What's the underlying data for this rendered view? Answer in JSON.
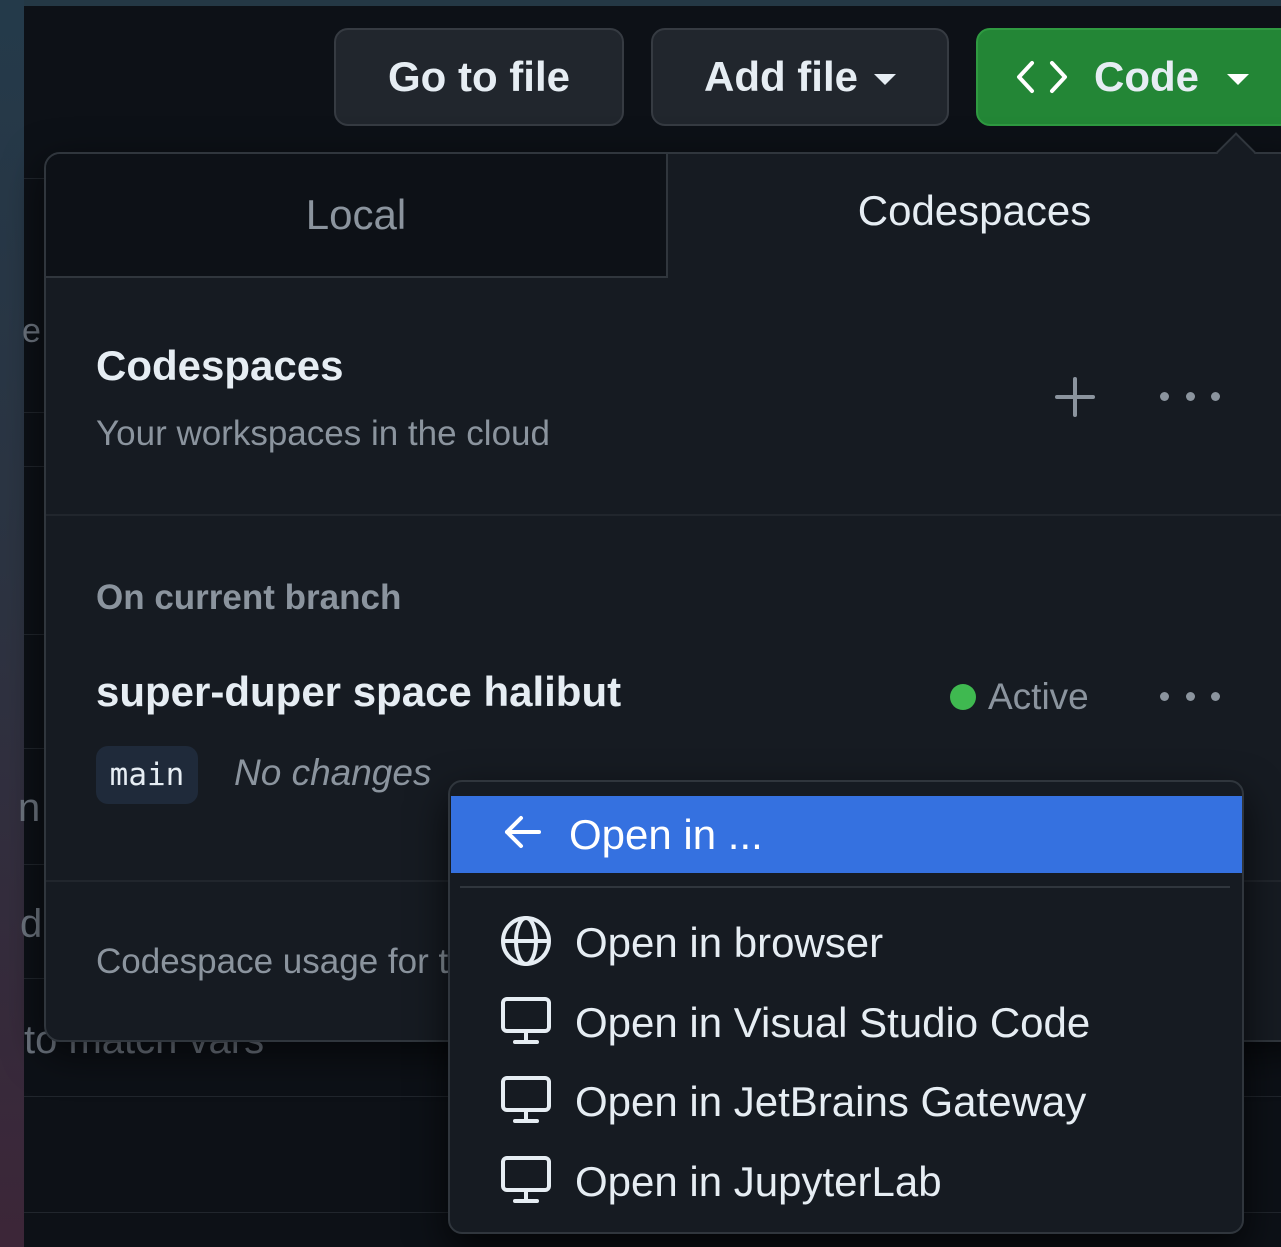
{
  "toolbar": {
    "goto_file_label": "Go to file",
    "add_file_label": "Add file",
    "code_label": "Code",
    "code_color": "#238636"
  },
  "background": {
    "fragment_e": "e",
    "fragment_n": "n",
    "fragment_d": "d",
    "fragment_vars": "to match vars"
  },
  "panel": {
    "tabs": [
      {
        "label": "Local",
        "selected": false
      },
      {
        "label": "Codespaces",
        "selected": true
      }
    ],
    "header": {
      "title": "Codespaces",
      "subtitle": "Your workspaces in the cloud",
      "add_icon": "plus-icon",
      "more_icon": "kebab-horizontal-icon"
    },
    "section_label": "On current branch",
    "codespace": {
      "name": "super-duper space halibut",
      "status": "Active",
      "status_color": "#3fb950",
      "branch": "main",
      "changes": "No changes"
    },
    "usage_text": "Codespace usage for t"
  },
  "menu": {
    "header": {
      "label": "Open in ...",
      "icon": "arrow-left-icon",
      "highlight_color": "#3571e0"
    },
    "items": [
      {
        "label": "Open in browser",
        "icon": "globe-icon"
      },
      {
        "label": "Open in Visual Studio Code",
        "icon": "desktop-icon"
      },
      {
        "label": "Open in JetBrains Gateway",
        "icon": "desktop-icon"
      },
      {
        "label": "Open in JupyterLab",
        "icon": "desktop-icon"
      }
    ]
  }
}
